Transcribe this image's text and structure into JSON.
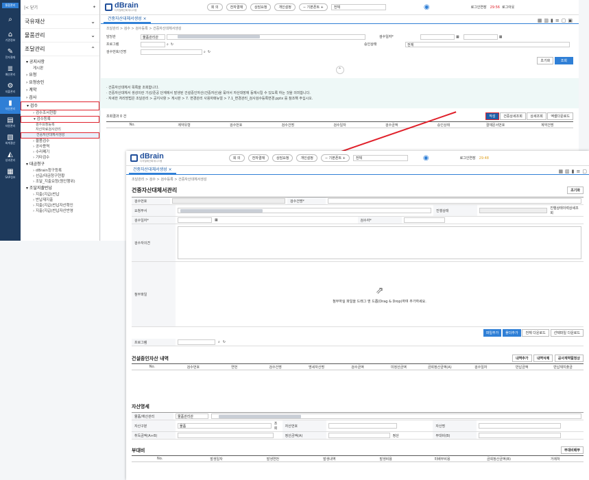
{
  "rail": {
    "badge": "통합관리",
    "items": [
      {
        "glyph": "⌕",
        "label": ""
      },
      {
        "glyph": "⌂",
        "label": "기관정보"
      },
      {
        "glyph": "✎",
        "label": "전자결재"
      },
      {
        "glyph": "≣",
        "label": "예산관리"
      },
      {
        "glyph": "⚙",
        "label": "지출관리"
      },
      {
        "glyph": "▮",
        "label": "자산관리"
      },
      {
        "glyph": "▤",
        "label": "자원관리"
      },
      {
        "glyph": "▧",
        "label": "회계결산"
      },
      {
        "glyph": "◭",
        "label": "성과관리"
      },
      {
        "glyph": "▦",
        "label": "SAP정보"
      }
    ]
  },
  "sidebar": {
    "back": "|< 닫기",
    "m1": [
      "국유재산",
      "물품관리",
      "조달관리"
    ],
    "items": [
      {
        "t": "m2",
        "label": "▾ 공지사항"
      },
      {
        "t": "m3",
        "label": "게시판"
      },
      {
        "t": "m2",
        "label": "› 요청"
      },
      {
        "t": "m2",
        "label": "› 요청승인"
      },
      {
        "t": "m2",
        "label": "› 계약"
      },
      {
        "t": "m2",
        "label": "› 검사"
      },
      {
        "t": "m2",
        "label": "▾ 검수",
        "box": true
      },
      {
        "t": "m3",
        "label": "› 검수조서현황"
      },
      {
        "t": "m3",
        "label": "▾ 검수등록",
        "box": true
      },
      {
        "t": "m4",
        "label": "검수요청등록"
      },
      {
        "t": "m4",
        "label": "자산자료검사관리"
      },
      {
        "t": "m4",
        "label": "건중자산대체서생성",
        "box": true,
        "sel": true
      },
      {
        "t": "m3",
        "label": "› 물품검수"
      },
      {
        "t": "m3",
        "label": "› 공사용역"
      },
      {
        "t": "m3",
        "label": "› 수리폐기"
      },
      {
        "t": "m3",
        "label": "› 기타검수"
      },
      {
        "t": "m2",
        "label": "▾ 대금청구"
      },
      {
        "t": "m3",
        "label": "› dBrain청구등록"
      },
      {
        "t": "m3",
        "label": "› 선급/대금청구현황"
      },
      {
        "t": "m3",
        "label": "› 조달_지출요청(원인행위)"
      },
      {
        "t": "m2",
        "label": "▾ 조달지출반납"
      },
      {
        "t": "m3",
        "label": "› 지출(지급)반납"
      },
      {
        "t": "m3",
        "label": "› 반납재지출"
      },
      {
        "t": "m3",
        "label": "› 지출(지급)반납자산확인"
      },
      {
        "t": "m3",
        "label": "› 지출(지급)반납자산반영"
      }
    ]
  },
  "header": {
    "logo": "dBrain",
    "logo_sub": "디지털예산회계시스템",
    "pills": [
      "회 의",
      "전자결재",
      "상담요청",
      "개인설정"
    ],
    "stepper": "기본폰트",
    "select": "전체",
    "login": "로그인연장",
    "timer": "29:56",
    "logout": "로그아웃"
  },
  "main": {
    "tab": "건중자산대체서생성",
    "tab_close": "×",
    "breadcrumb": "조달관리 > 검수 > 검수등록 > 건중자산대체서생성",
    "form": {
      "dept": "담당관",
      "dept_val": "물품관리관",
      "date": "검수일자*",
      "prog": "프로그램",
      "appr": "승인상태",
      "appr_val": "전체",
      "no": "검수번호/건명"
    },
    "reset": "초기화",
    "search": "조회",
    "toggle": "⌃",
    "notice": [
      "· 건중자산대체서 목록을 조회합니다.",
      "· 건중자산대체서 생성이란 기성/준공 단계에서 발생된 건설중인자산(건중자산)을 묶어서 자산대장에 등재시킬 수 있도록 하는 것을 의미합니다.",
      "· 자세한 처리방법은 조달관리 > 공지사항 > 게시판 > 7. 변경관리 사용자매뉴얼 > 7.1_변경관리_검사검수등록변경.pptx 를 참조해 주십시오."
    ],
    "result": "조회결과 0 건",
    "actions": [
      "작성",
      "건중상세조회",
      "상세조회",
      "엑셀다운로드"
    ],
    "cols": [
      "No.",
      "계약유형",
      "검수번호",
      "검수건명",
      "검수일자",
      "검수금액",
      "승인상태",
      "결재문서번호",
      "계약건명"
    ]
  },
  "popup": {
    "tab": "건중자산대체서생성",
    "tab_close": "×",
    "breadcrumb": "조달관리 > 검수 > 검수등록 > 건중자산대체서생성",
    "title": "건중자산대체서관리",
    "reset": "초기화",
    "labels": {
      "no": "검수번호",
      "name": "검수건명*",
      "dept": "요청부서",
      "state": "진행상태",
      "state_btn": "진행상태이력상세조회",
      "date": "검수일자*",
      "amt": "검수자*",
      "opinion": "검수자의견",
      "attach": "첨부파일",
      "prog": "프로그램"
    },
    "drop": "첨부하실 파일을 드래그 앤 드롭(Drag & Drop)하여 추가하세요.",
    "file_btns": [
      "파일추가",
      "폴더추가",
      "전체 다운로드",
      "선택파일 다운로드"
    ],
    "sec1": "건설중인자산 내역",
    "sec1_btns": [
      "내역추가",
      "내역삭제",
      "공사계약활정상"
    ],
    "cols1": [
      "No.",
      "검수번호",
      "연번",
      "검수건명",
      "명세자산명",
      "검수금액",
      "미정산금액",
      "금회정산금액(A)",
      "검수일자",
      "반납금액",
      "반납재지출금"
    ],
    "sec2": "자산명세",
    "assets": {
      "l1": "물품/재산관리",
      "v1": "물품관리관",
      "l2": "자산구분",
      "v2": "물품",
      "q": "조회",
      "l3": "자산번호",
      "l4": "자산명",
      "l5": "취득금액(A+B)",
      "l6": "정산금액(A)",
      "calc": "정산",
      "l7": "부대비(B)"
    },
    "sec3": "부대비",
    "sec3_btn": "부대비배부",
    "cols3": [
      "No.",
      "발생일자",
      "발생연번",
      "발생내역",
      "발생비용",
      "미배부비용",
      "금회정산금액(B)",
      "거래처"
    ]
  }
}
